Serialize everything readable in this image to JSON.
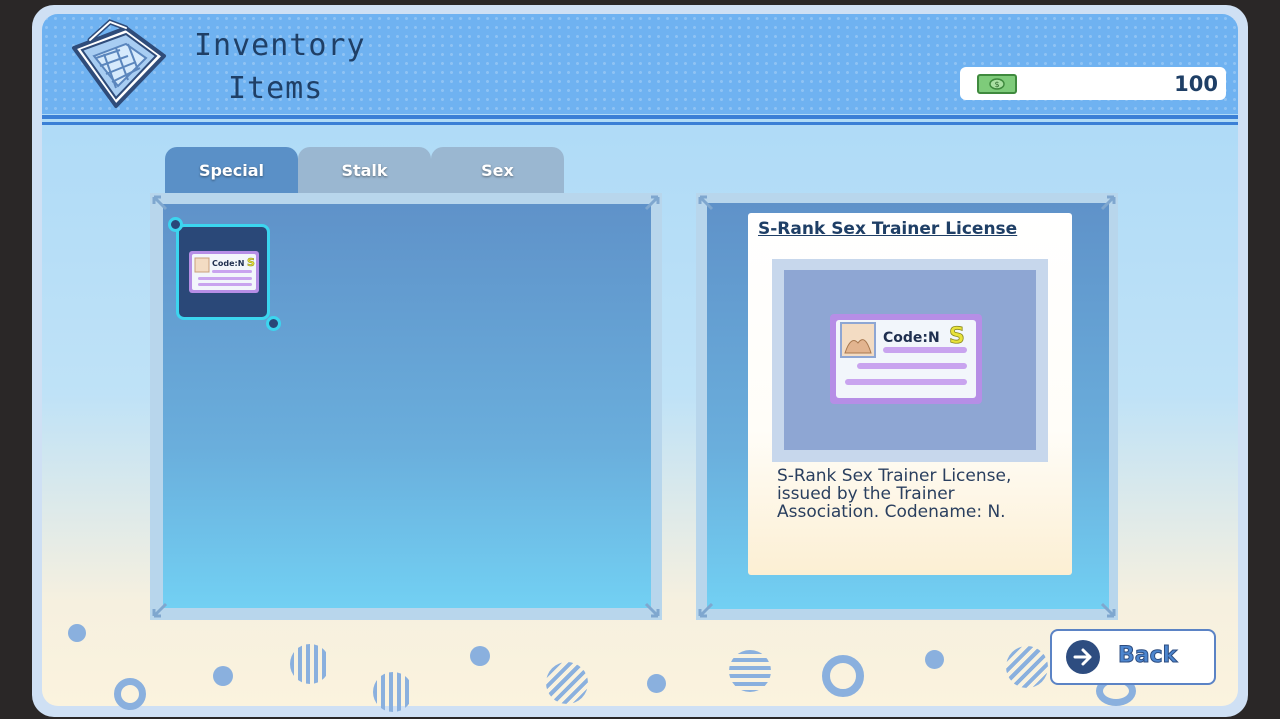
{
  "header": {
    "title_line1": "Inventory",
    "title_line2": "Items",
    "money": "100"
  },
  "tabs": [
    {
      "label": "Special",
      "active": true
    },
    {
      "label": "Stalk",
      "active": false
    },
    {
      "label": "Sex",
      "active": false
    }
  ],
  "inventory": {
    "slots": [
      {
        "card_code": "Code:N",
        "card_rank": "S",
        "selected": true
      }
    ]
  },
  "detail": {
    "name": "S-Rank Sex Trainer License",
    "card_code": "Code:N",
    "card_rank": "S",
    "description": "S-Rank Sex Trainer License, issued by the Trainer Association. Codename: N."
  },
  "back_button": {
    "label": "Back"
  },
  "colors": {
    "accent": "#3cd5ef",
    "header": "#6fb2f1",
    "title_text": "#1f3f66",
    "card_purple": "#b68ee6",
    "rank_yellow": "#e8e23a"
  }
}
